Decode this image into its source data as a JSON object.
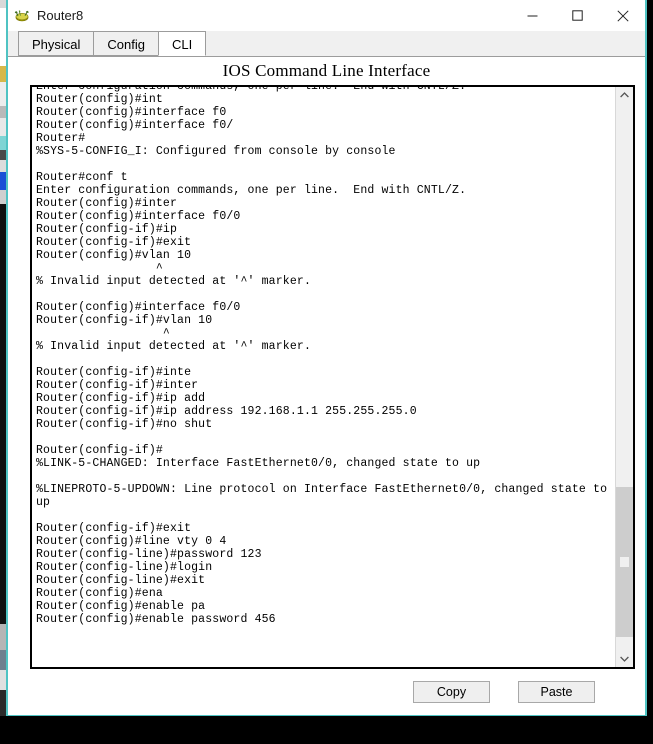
{
  "window": {
    "title": "Router8",
    "icon": "router-device-icon",
    "controls": {
      "minimize": "─",
      "maximize": "□",
      "close": "✕"
    },
    "border_color": "#4fc3c3"
  },
  "tabs": [
    {
      "label": "Physical",
      "active": false
    },
    {
      "label": "Config",
      "active": false
    },
    {
      "label": "CLI",
      "active": true
    }
  ],
  "content": {
    "heading": "IOS Command Line Interface"
  },
  "terminal": {
    "text": "Enter configuration commands, one per line.  End with CNTL/Z.\nRouter(config)#int\nRouter(config)#interface f0\nRouter(config)#interface f0/\nRouter#\n%SYS-5-CONFIG_I: Configured from console by console\n\nRouter#conf t\nEnter configuration commands, one per line.  End with CNTL/Z.\nRouter(config)#inter\nRouter(config)#interface f0/0\nRouter(config-if)#ip\nRouter(config-if)#exit\nRouter(config)#vlan 10\n                 ^\n% Invalid input detected at '^' marker.\n\nRouter(config)#interface f0/0\nRouter(config-if)#vlan 10\n                  ^\n% Invalid input detected at '^' marker.\n\nRouter(config-if)#inte\nRouter(config-if)#inter\nRouter(config-if)#ip add\nRouter(config-if)#ip address 192.168.1.1 255.255.255.0\nRouter(config-if)#no shut\n\nRouter(config-if)#\n%LINK-5-CHANGED: Interface FastEthernet0/0, changed state to up\n\n%LINEPROTO-5-UPDOWN: Line protocol on Interface FastEthernet0/0, changed state to\nup\n\nRouter(config-if)#exit\nRouter(config)#line vty 0 4\nRouter(config-line)#password 123\nRouter(config-line)#login\nRouter(config-line)#exit\nRouter(config)#ena\nRouter(config)#enable pa\nRouter(config)#enable password 456",
    "scrollbar": {
      "up_arrow": "⌃",
      "down_arrow": "⌄"
    }
  },
  "buttons": {
    "copy": "Copy",
    "paste": "Paste"
  }
}
